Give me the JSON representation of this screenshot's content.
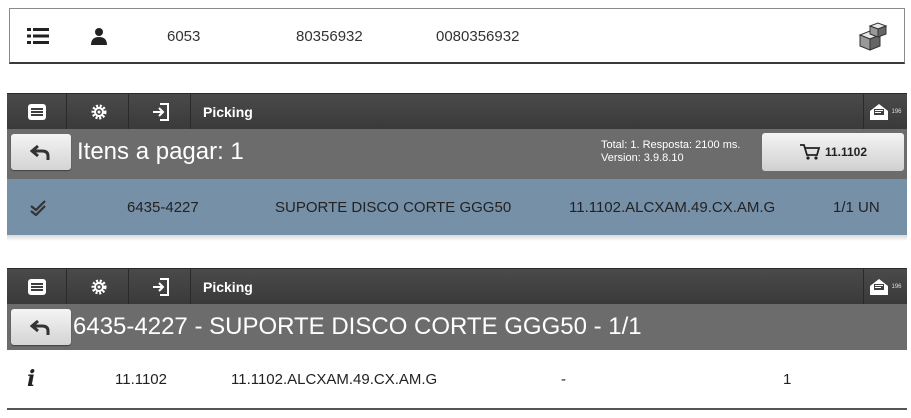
{
  "panel1": {
    "icons": [
      "list-icon",
      "user-icon",
      "packages-icon"
    ],
    "values": [
      "6053",
      "80356932",
      "0080356932"
    ]
  },
  "toolbar": {
    "title": "Picking",
    "icons": [
      "menu-icon",
      "gear-icon",
      "login-icon",
      "mail-icon"
    ],
    "mail_badge": "196"
  },
  "picking_list": {
    "header_title": "Itens a pagar: 1",
    "status_line1": "Total: 1. Resposta: 2100 ms.",
    "status_line2": "Version: 3.9.8.10",
    "cart_label": "11.1102",
    "row": {
      "code": "6435-4227",
      "description": "SUPORTE DISCO CORTE GGG50",
      "location": "11.1102.ALCXAM.49.CX.AM.G",
      "quantity": "1/1 UN"
    }
  },
  "item_detail": {
    "header_title": "6435-4227 - SUPORTE DISCO CORTE GGG50 - 1/1",
    "info_label": "i",
    "row": {
      "address": "11.1102",
      "location": "11.1102.ALCXAM.49.CX.AM.G",
      "lot": "-",
      "quantity": "1"
    }
  },
  "colors": {
    "toolbar": "#3f3f3f",
    "header_bar": "#6c6c6c",
    "selected_row": "#7690a8"
  }
}
